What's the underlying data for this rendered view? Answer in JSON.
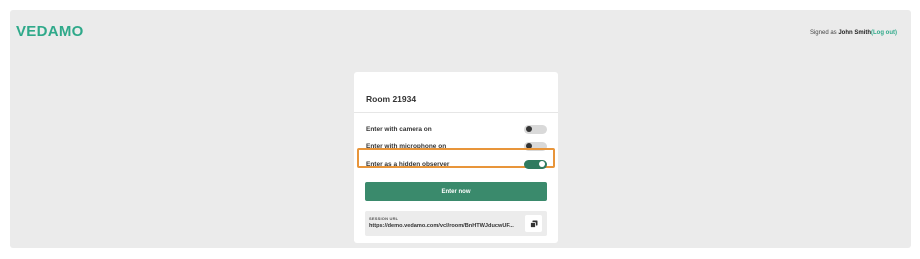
{
  "header": {
    "logo_text": "VEDAMO",
    "signed_prefix": "Signed as",
    "user_name": "John Smith",
    "logout_label": "(Log out)"
  },
  "card": {
    "title": "Room 21934",
    "options": [
      {
        "label": "Enter with camera on",
        "enabled": false
      },
      {
        "label": "Enter with microphone on",
        "enabled": false
      },
      {
        "label": "Enter as a hidden observer",
        "enabled": true
      }
    ],
    "enter_button_label": "Enter now",
    "session_url_caption": "SESSION URL",
    "session_url": "https://demo.vedamo.com/vcl/room/BnHTWJducwUF..."
  },
  "colors": {
    "brand": "#2fa98a",
    "toggle_on": "#2f7a5f",
    "button": "#3a8a6c",
    "highlight": "#e8953a"
  },
  "icons": {
    "copy": "copy-icon"
  }
}
